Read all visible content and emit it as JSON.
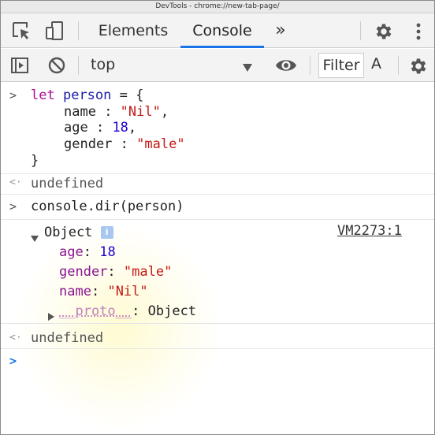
{
  "window": {
    "title": "DevTools - chrome://new-tab-page/"
  },
  "tabs": [
    {
      "label": "Elements"
    },
    {
      "label": "Console"
    }
  ],
  "tab_more_label": "»",
  "toolbar": {
    "context": "top",
    "filter_label": "Filter",
    "font_label": "A"
  },
  "console": {
    "prompt_symbol": ">",
    "return_symbol": "<·",
    "input1": {
      "keyword": "let",
      "var_name": "person",
      "open": "= {",
      "props": [
        {
          "key": "name",
          "sep": " : ",
          "value": "\"Nil\"",
          "tail": ","
        },
        {
          "key": "age",
          "sep": " : ",
          "value": "18",
          "tail": ","
        },
        {
          "key": "gender",
          "sep": " : ",
          "value": "\"male\"",
          "tail": ""
        }
      ],
      "close": "}"
    },
    "result1": "undefined",
    "input2": "console.dir(person)",
    "output": {
      "label": "Object",
      "info_badge": "i",
      "source_link": "VM2273:1",
      "props": [
        {
          "key": "age",
          "value": "18"
        },
        {
          "key": "gender",
          "value": "\"male\""
        },
        {
          "key": "name",
          "value": "\"Nil\""
        }
      ],
      "proto_key": "__proto__",
      "proto_value": "Object",
      "colon": ":"
    },
    "result2": "undefined"
  },
  "colors": {
    "accent": "#1a73e8",
    "keyword": "#aa0d91",
    "string": "#c41a16",
    "number": "#1c00cf"
  }
}
